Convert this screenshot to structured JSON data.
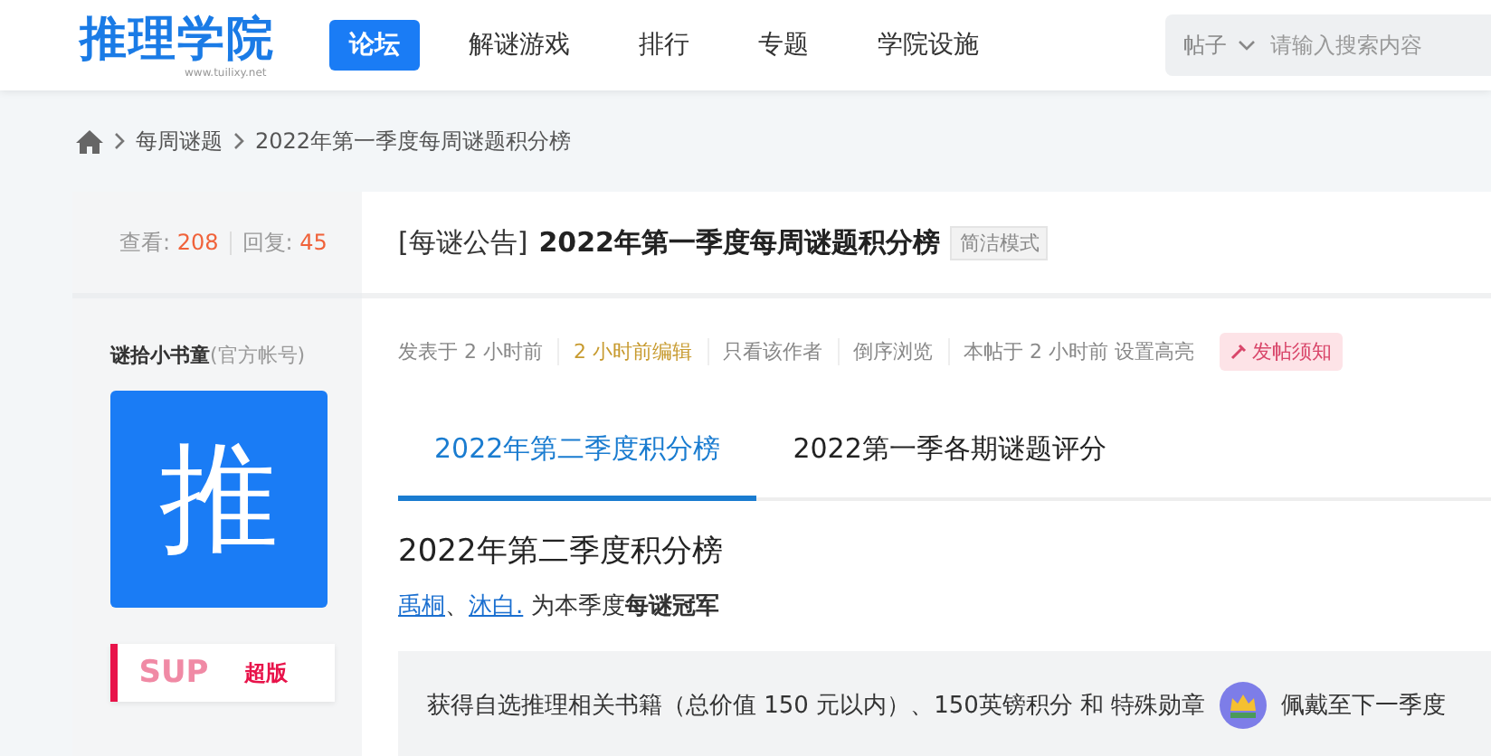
{
  "header": {
    "logo": "推理学院",
    "logo_sub": "www.tuilixy.net",
    "nav": [
      {
        "label": "论坛",
        "selected": true
      },
      {
        "label": "解谜游戏",
        "selected": false
      },
      {
        "label": "排行",
        "selected": false
      },
      {
        "label": "专题",
        "selected": false
      },
      {
        "label": "学院设施",
        "selected": false
      }
    ],
    "search": {
      "scope": "帖子",
      "placeholder": "请输入搜索内容"
    }
  },
  "breadcrumb": [
    "每周谜题",
    "2022年第一季度每周谜题积分榜"
  ],
  "stats": {
    "views_label": "查看:",
    "views": "208",
    "replies_label": "回复:",
    "replies": "45"
  },
  "thread": {
    "prefix": "[每谜公告]",
    "title": "2022年第一季度每周谜题积分榜",
    "mode_tag": "简洁模式"
  },
  "author": {
    "name": "谜拾小书童",
    "note": "(官方帐号)",
    "avatar_glyph": "推",
    "badge": {
      "left": "SUP",
      "right": "超版"
    }
  },
  "meta": [
    {
      "text": "发表于 2 小时前",
      "kind": "plain"
    },
    {
      "text": "2 小时前编辑",
      "kind": "edited"
    },
    {
      "text": "只看该作者",
      "kind": "link"
    },
    {
      "text": "倒序浏览",
      "kind": "link"
    },
    {
      "text": "本帖于 2 小时前 设置高亮",
      "kind": "plain"
    }
  ],
  "notice_button": "发帖须知",
  "tabs": [
    {
      "label": "2022年第二季度积分榜",
      "selected": true
    },
    {
      "label": "2022第一季各期谜题评分",
      "selected": false
    }
  ],
  "content": {
    "heading": "2022年第二季度积分榜",
    "winners": [
      "禹桐",
      "沐白."
    ],
    "winner_sep": "、",
    "winner_text": "为本季度**每谜冠军**",
    "reward_before": "获得自选推理相关书籍（总价值 150 元以内）、150英镑积分 和 特殊勋章",
    "reward_after": "佩戴至下一季度"
  }
}
